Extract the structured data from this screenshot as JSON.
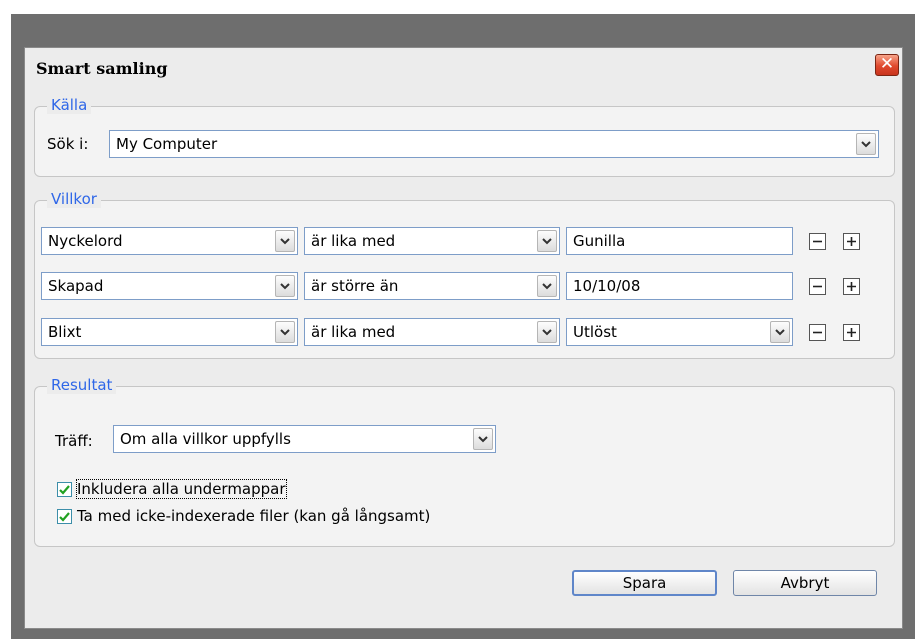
{
  "dialog": {
    "title": "Smart samling",
    "close_icon": "close-icon"
  },
  "source": {
    "legend": "Källa",
    "search_label": "Sök i:",
    "search_value": "My Computer"
  },
  "conditions": {
    "legend": "Villkor",
    "rows": [
      {
        "field": "Nyckelord",
        "operator": "är lika med",
        "value": "Gunilla",
        "value_type": "text"
      },
      {
        "field": "Skapad",
        "operator": "är större än",
        "value": "10/10/08",
        "value_type": "text"
      },
      {
        "field": "Blixt",
        "operator": "är lika med",
        "value": "Utlöst",
        "value_type": "select"
      }
    ],
    "remove_icon": "minus-icon",
    "add_icon": "plus-icon"
  },
  "result": {
    "legend": "Resultat",
    "match_label": "Träff:",
    "match_value": "Om alla villkor uppfylls",
    "include_subfolders": {
      "label": "Inkludera alla undermappar",
      "checked": true
    },
    "include_unindexed": {
      "label": "Ta med icke-indexerade filer (kan gå långsamt)",
      "checked": true
    }
  },
  "buttons": {
    "save": "Spara",
    "cancel": "Avbryt"
  },
  "colors": {
    "accent": "#2f67e8",
    "close": "#e0492e",
    "frame": "#6e6e6e"
  }
}
